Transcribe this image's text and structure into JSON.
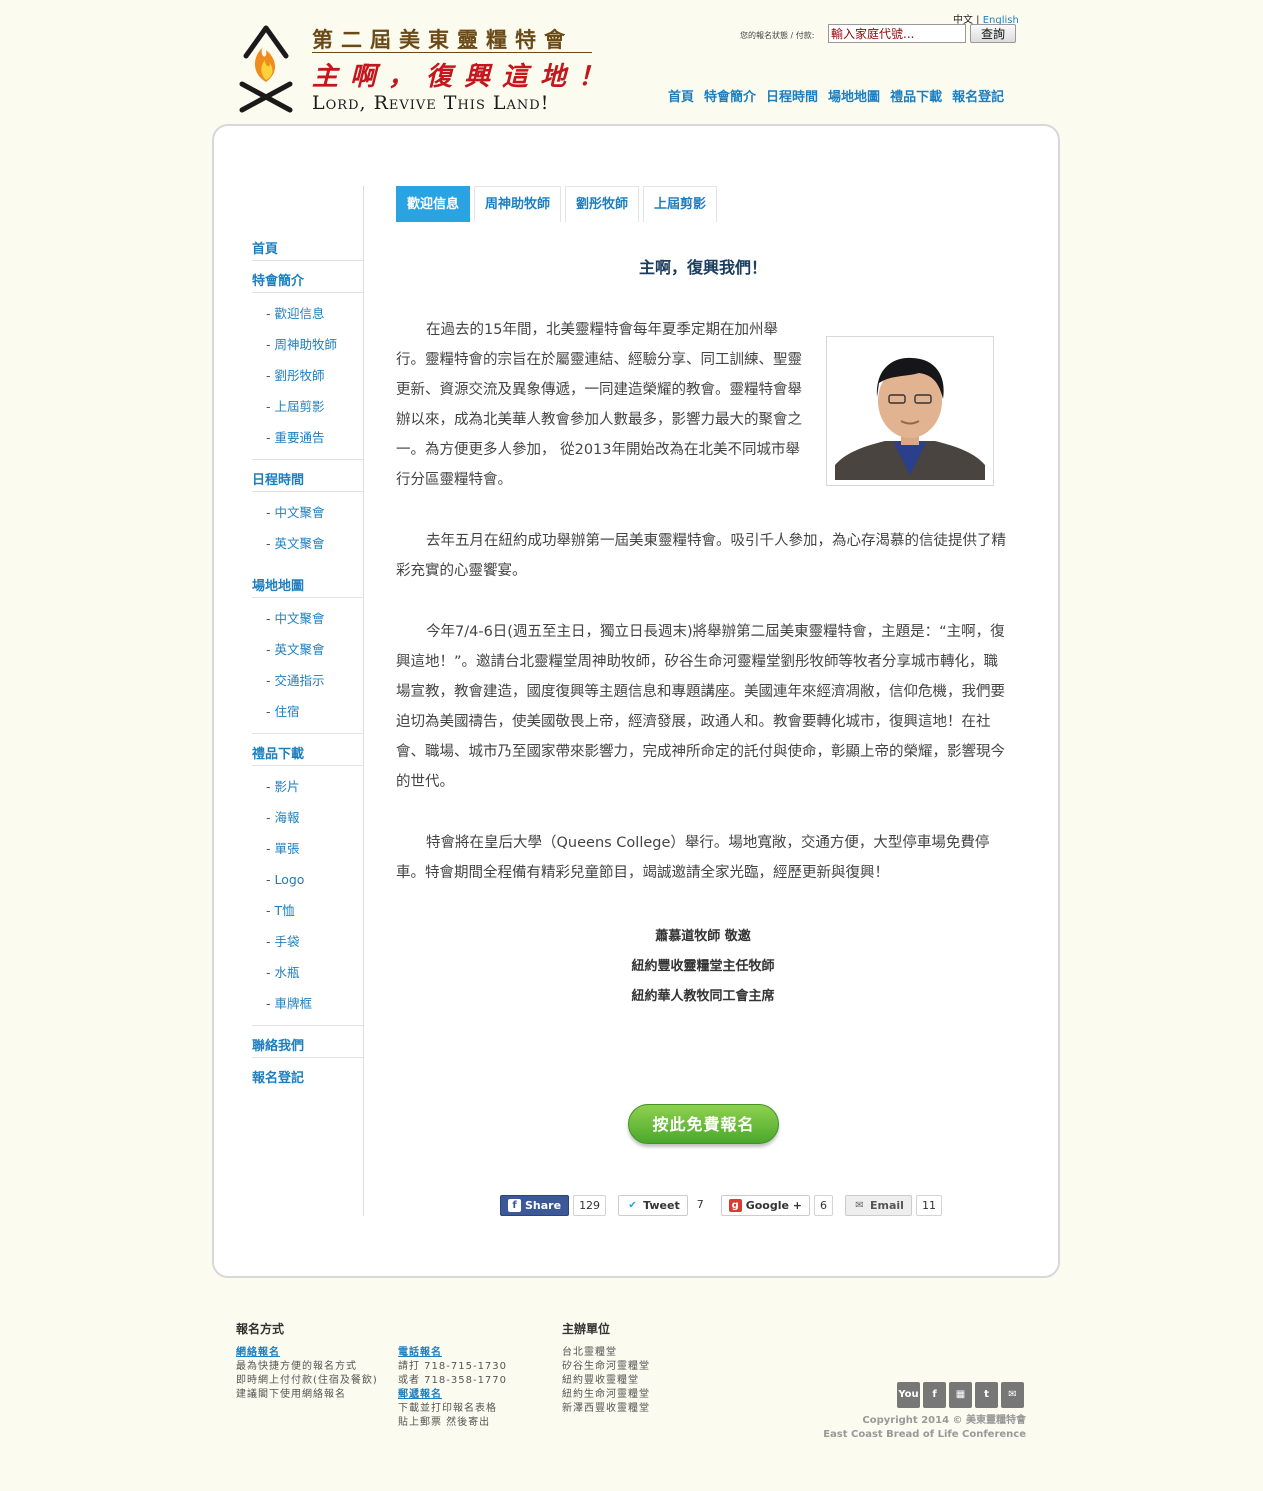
{
  "header": {
    "logo_title": "第二屆美東靈糧特會",
    "logo_slogan": "主啊，復興這地！",
    "logo_english": "Lord, Revive This Land!",
    "lang_zh": "中文",
    "lang_en": "English",
    "reg_label": "您的報名狀態 / 付款:",
    "reg_placeholder": "輸入家庭代號...",
    "reg_button": "查詢"
  },
  "topnav": [
    "首頁",
    "特會簡介",
    "日程時間",
    "場地地圖",
    "禮品下載",
    "報名登記"
  ],
  "sidebar": {
    "home": "首頁",
    "intro": "特會簡介",
    "intro_items": [
      "歡迎信息",
      "周神助牧師",
      "劉彤牧師",
      "上屆剪影",
      "重要通告"
    ],
    "schedule": "日程時間",
    "schedule_items": [
      "中文聚會",
      "英文聚會"
    ],
    "venue": "場地地圖",
    "venue_items": [
      "中文聚會",
      "英文聚會",
      "交通指示",
      "住宿"
    ],
    "gifts": "禮品下載",
    "gift_items": [
      "影片",
      "海報",
      "單張",
      "Logo",
      "T恤",
      "手袋",
      "水瓶",
      "車牌框"
    ],
    "contact": "聯絡我們",
    "register": "報名登記"
  },
  "tabs": [
    "歡迎信息",
    "周神助牧師",
    "劉彤牧師",
    "上屆剪影"
  ],
  "content": {
    "title": "主啊，復興我們！",
    "p1": "在過去的15年間，北美靈糧特會每年夏季定期在加州舉行。靈糧特會的宗旨在於屬靈連結、經驗分享、同工訓練、聖靈更新、資源交流及異象傳遞，一同建造榮耀的教會。靈糧特會舉辦以來，成為北美華人教會參加人數最多，影響力最大的聚會之一。為方便更多人參加， 從2013年開始改為在北美不同城市舉行分區靈糧特會。",
    "p2": "去年五月在紐約成功舉辦第一屆美東靈糧特會。吸引千人參加，為心存渴慕的信徒提供了精彩充實的心靈饗宴。",
    "p3": "今年7/4-6日(週五至主日，獨立日長週末)將舉辦第二屆美東靈糧特會，主題是：“主啊，復興這地！”。邀請台北靈糧堂周神助牧師，矽谷生命河靈糧堂劉彤牧師等牧者分享城市轉化，職場宣教，教會建造，國度復興等主題信息和專題講座。美國連年來經濟凋敝，信仰危機，我們要迫切為美國禱告，使美國敬畏上帝，經濟發展，政通人和。教會要轉化城市，復興這地！在社會、職場、城市乃至國家帶來影響力，完成神所命定的託付與使命，彰顯上帝的榮耀，影響現今的世代。",
    "p4": "特會將在皇后大學（Queens College）舉行。場地寬敞，交通方便，大型停車場免費停車。特會期間全程備有精彩兒童節目，竭誠邀請全家光臨，經歷更新與復興！",
    "sign1": "蕭慕道牧師 敬邀",
    "sign2": "紐約豐收靈糧堂主任牧師",
    "sign3": "紐約華人教牧同工會主席",
    "cta": "按此免費報名"
  },
  "share": [
    {
      "label": "Share",
      "count": "129",
      "icon": "facebook-icon"
    },
    {
      "label": "Tweet",
      "count": "7",
      "icon": "twitter-icon"
    },
    {
      "label": "Google +",
      "count": "6",
      "icon": "google-plus-icon"
    },
    {
      "label": "Email",
      "count": "11",
      "icon": "email-icon"
    }
  ],
  "footer": {
    "reg_heading": "報名方式",
    "online_title": "網絡報名",
    "online_lines": [
      "最為快捷方便的報名方式",
      "即時網上付付款(住宿及餐飲)",
      "建議閣下使用網絡報名"
    ],
    "phone_title": "電話報名",
    "phone_lines": [
      "請打 718-715-1730",
      "或者 718-358-1770"
    ],
    "mail_title": "郵遞報名",
    "mail_lines": [
      "下載並打印報名表格",
      "貼上郵票 然後寄出"
    ],
    "host_heading": "主辦單位",
    "hosts": [
      "台北靈糧堂",
      "矽谷生命河靈糧堂",
      "紐約豐收靈糧堂",
      "紐約生命河靈糧堂",
      "新澤西豐收靈糧堂"
    ],
    "social": [
      "youtube-icon",
      "facebook-icon",
      "feed-icon",
      "twitter-icon",
      "email-icon"
    ],
    "copyright": "Copyright 2014 © 美東靈糧特會",
    "copyright_en": "East Coast Bread of Life Conference"
  }
}
